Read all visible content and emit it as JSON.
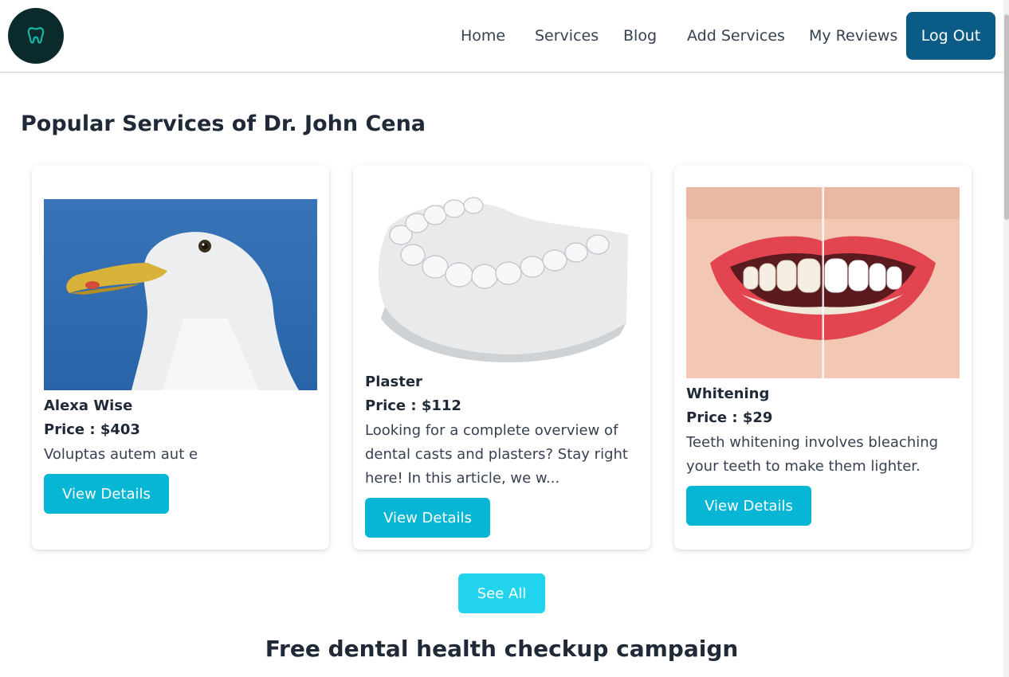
{
  "nav": {
    "logo_icon": "tooth-icon",
    "links": [
      "Home",
      "Services",
      "Blog",
      "Add Services",
      "My Reviews"
    ],
    "logout_label": "Log Out"
  },
  "section_title": "Popular Services of Dr. John Cena",
  "services": [
    {
      "name": "Alexa Wise",
      "price": "Price : $403",
      "description": "Voluptas autem aut e",
      "button": "View Details",
      "image": "seagull-photo"
    },
    {
      "name": "Plaster",
      "price": "Price : $112",
      "description": "Looking for a complete overview of dental casts and plasters? Stay right here! In this article, we w...",
      "button": "View Details",
      "image": "dental-plaster-cast-photo"
    },
    {
      "name": "Whitening",
      "price": "Price : $29",
      "description": "Teeth whitening involves bleaching your teeth to make them lighter.",
      "button": "View Details",
      "image": "teeth-whitening-photo"
    }
  ],
  "see_all_label": "See All",
  "campaign_title": "Free dental health checkup campaign",
  "colors": {
    "primary": "#0b5b87",
    "accent": "#06b6d4",
    "see_all": "#22d3ee",
    "logo_bg": "#0b2a2c"
  }
}
